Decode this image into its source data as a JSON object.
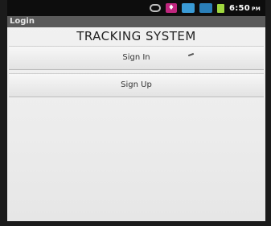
{
  "status_bar": {
    "time": "6:50",
    "ampm": "PM",
    "icons": [
      "sync-icon",
      "notification-icon",
      "gallery-icon",
      "signal-icon",
      "battery-icon"
    ]
  },
  "window": {
    "title": "Login"
  },
  "main": {
    "heading": "TRACKING SYSTEM",
    "signin_label": "Sign In",
    "signup_label": "Sign Up"
  },
  "colors": {
    "status_bar_bg": "#0d0d0d",
    "title_bar_bg": "#5a5a5a",
    "screen_bg": "#efefef"
  }
}
